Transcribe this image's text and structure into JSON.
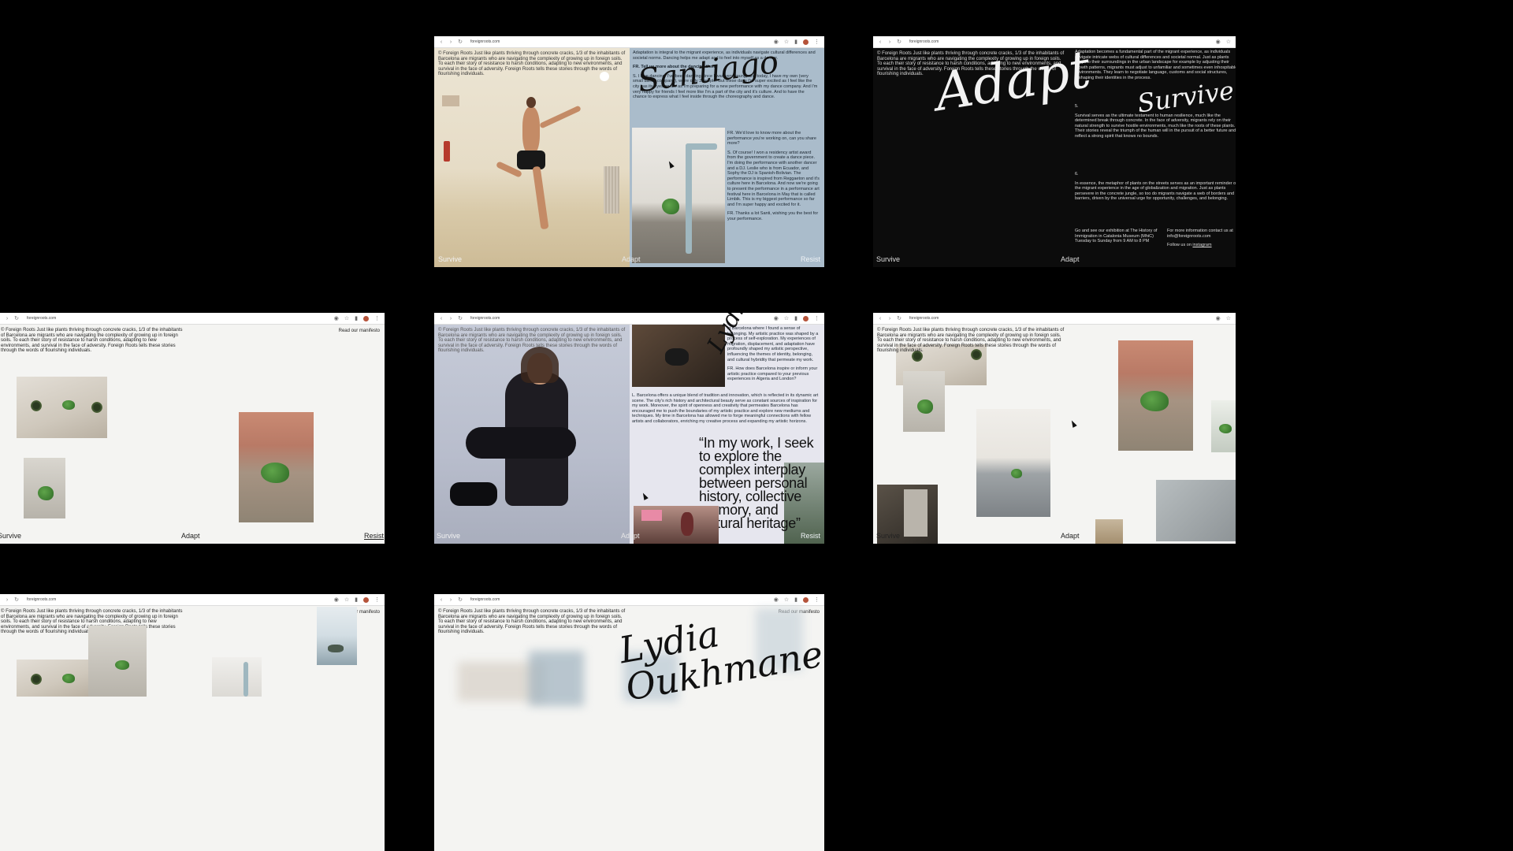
{
  "browser": {
    "url": "foreignroots.com"
  },
  "intro": "© Foreign Roots Just like plants thriving through concrete cracks, 1/3 of the inhabitants of Barcelona are migrants who are navigating the complexity of growing up in foreign soils. To each their story of resistance to harsh conditions, adapting to new environments, and survival in the face of adversity. Foreign Roots tells these stories through the words of flourishing individuals.",
  "nav": {
    "survive": "Survive",
    "adapt": "Adapt",
    "resist": "Resist"
  },
  "manifesto": "Read our manifesto",
  "panel_santi": {
    "script_name": "Santiago",
    "p1": "Adaptation is integral to the migrant experience, as individuals navigate cultural differences and societal norms. Dancing helps me adapt and to feel into myself as a dancer.",
    "p2": "FR. Tell us more about the dancing then.",
    "p3": "S. I love dancing. I've been dancing since I was very young, and today, I have my own (very small dance company), we're only 2 people. But these days I'm super excited as I feel like the city has its eyes on me as I'm preparing for a new performance with my dance company. And I'm very happy for friends I feel more like I'm a part of the city and it's culture. And to have the chance to express what I feel inside through the choreography and dance.",
    "p4": "FR. We'd love to know more about the performance you're working on, can you share more?",
    "p5": "S. Of course! I won a residency artist award from the government to create a dance piece. I'm doing the performance with another dancer and a DJ. Leslie who is from Ecuador, and Sophy the DJ is Spanish-Bolivian. The performance is inspired from Reggaeton and it's culture here in Barcelona. And now we're going to present the performance in a performance art festival here in Barcelona in May that is called Limbik. This is my biggest performance so far and I'm super happy and excited for it.",
    "p6": "FR. Thanks a lot Santi, wishing you the best for your performance."
  },
  "panel_adapt": {
    "script_adapt": "Adapt",
    "script_survive": "Survive",
    "p_top": "Adaptation becomes a fundamental part of the migrant experience, as individuals navigate intricate webs of cultural differences and societal normal. Just as plants adapt to their surroundings in the urban landscape for example by adjusting their growth patterns, migrants must adjust to unfamiliar and sometimes even inhospitable environments. They learn to negotiate language, customs and social structures, reshaping their identities in the process.",
    "n5": "5.",
    "p5": "Survival serves as the ultimate testament to human resilience, much like the determined break through concrete. In the face of adversity, migrants rely on their natural strength to survive hostile environments, much like the roots of these plants. Their stories reveal the triumph of the human will in the pursuit of a better future and reflect a strong spirit that knows no bounds.",
    "n6": "6.",
    "p6": "In essence, the metaphor of plants on the streets serves as an important reminder of the migrant experience in the age of globalization and migration. Just as plants persevere in the concrete jungle, so too do migrants navigate a web of borders and barriers, driven by the universal urge for opportunity, challenges, and belonging.",
    "exhibit": "Go and see our exhibition at The History of Immigration in Catalonia Museum (MhiC) Tuesday to Sunday from 9 AM to 8 PM",
    "contact": "For more information contact us at info@foreignroots.com",
    "follow_prefix": "Follow us on ",
    "follow_link": "instagram"
  },
  "panel_lydia": {
    "script_name": "Lydia Oukhmane",
    "p1": "in Barcelona where I found a sense of belonging. My artistic practice was shaped by a process of self-exploration. My experiences of migration, displacement, and adaptation have profoundly shaped my artistic perspective, influencing the themes of identity, belonging, and cultural hybridity that permeate my work.",
    "p2": "FR. How does Barcelona inspire or inform your artistic practice compared to your previous experiences in Algeria and London?",
    "p3": "L. Barcelona offers a unique blend of tradition and innovation, which is reflected in its dynamic art scene. The city's rich history and architectural beauty serve as constant sources of inspiration for my work. Moreover, the spirit of openness and creativity that permeates Barcelona has encouraged me to push the boundaries of my artistic practice and explore new mediums and techniques. My time in Barcelona has allowed me to forge meaningful connections with fellow artists and collaborators, enriching my creative process and expanding my artistic horizons.",
    "quote": "“In my work, I seek to explore the complex interplay between personal history, collective memory, and cultural heritage”"
  },
  "panel_lydia_intro": {
    "script_name": "Lydia Oukhmane"
  }
}
